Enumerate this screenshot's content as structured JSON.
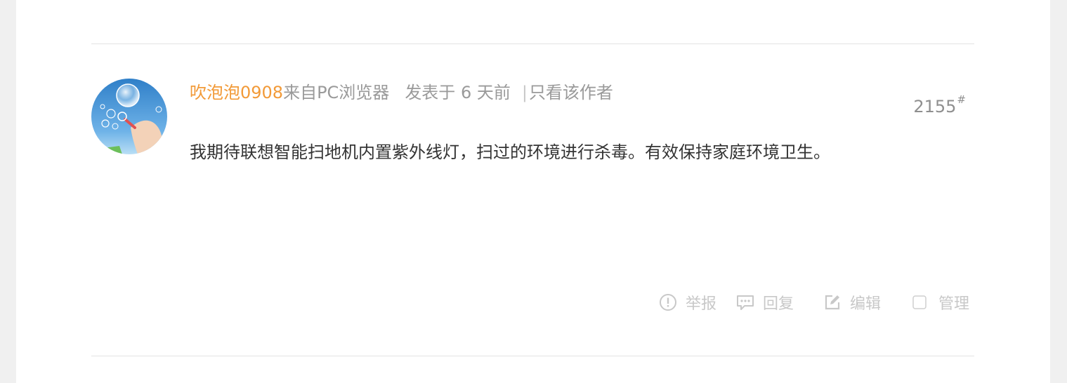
{
  "post": {
    "author": "吹泡泡0908",
    "source": "来自PC浏览器",
    "posted": "发表于 6 天前",
    "separator": "|",
    "only_author": "只看该作者",
    "floor_number": "2155",
    "floor_mark": "#",
    "content": "我期待联想智能扫地机内置紫外线灯，扫过的环境进行杀毒。有效保持家庭环境卫生。"
  },
  "actions": {
    "report": "举报",
    "reply": "回复",
    "edit": "编辑",
    "manage": "管理"
  },
  "icons": {
    "report": "exclamation-circle-icon",
    "reply": "chat-bubble-icon",
    "edit": "pencil-square-icon",
    "manage": "checkbox-icon"
  },
  "colors": {
    "author": "#f29a38",
    "meta": "#9a9a9a",
    "content": "#333333",
    "actions": "#c8c8c8"
  }
}
